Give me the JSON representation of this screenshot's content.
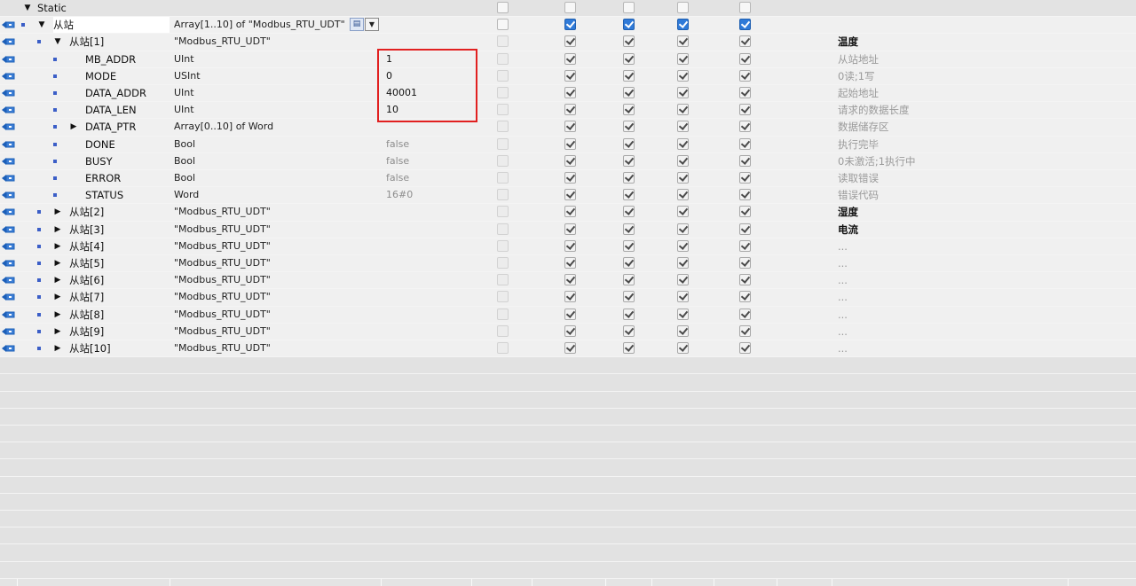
{
  "rows": [
    {
      "level": 0,
      "expander": "down",
      "icon": false,
      "name": "Static",
      "type": "",
      "value": "",
      "comment": "",
      "hdr": true,
      "cbs": [
        "grey",
        "grey",
        "grey",
        "grey",
        "grey"
      ]
    },
    {
      "level": 1,
      "expander": "down",
      "icon": true,
      "name": "从站",
      "type": "Array[1..10] of \"Modbus_RTU_UDT\"",
      "value": "",
      "comment": "",
      "selected": true,
      "cbs": [
        "grey",
        "blue",
        "blue",
        "blue",
        "blue"
      ],
      "col1": "grey"
    },
    {
      "level": 2,
      "expander": "down",
      "icon": true,
      "name": "从站[1]",
      "type": "\"Modbus_RTU_UDT\"",
      "value": "",
      "comment": "温度",
      "commentBold": true,
      "cbs": [
        "dis",
        "on",
        "on",
        "on",
        "on"
      ]
    },
    {
      "level": 3,
      "expander": "",
      "icon": true,
      "name": "MB_ADDR",
      "type": "UInt",
      "value": "1",
      "comment": "从站地址",
      "cbs": [
        "dis",
        "on",
        "on",
        "on",
        "on"
      ]
    },
    {
      "level": 3,
      "expander": "",
      "icon": true,
      "name": "MODE",
      "type": "USInt",
      "value": "0",
      "comment": "0读;1写",
      "cbs": [
        "dis",
        "on",
        "on",
        "on",
        "on"
      ]
    },
    {
      "level": 3,
      "expander": "",
      "icon": true,
      "name": "DATA_ADDR",
      "type": "UInt",
      "value": "40001",
      "comment": "起始地址",
      "cbs": [
        "dis",
        "on",
        "on",
        "on",
        "on"
      ]
    },
    {
      "level": 3,
      "expander": "",
      "icon": true,
      "name": "DATA_LEN",
      "type": "UInt",
      "value": "10",
      "comment": "请求的数据长度",
      "cbs": [
        "dis",
        "on",
        "on",
        "on",
        "on"
      ]
    },
    {
      "level": 3,
      "expander": "right",
      "icon": true,
      "name": "DATA_PTR",
      "type": "Array[0..10] of Word",
      "value": "",
      "comment": "数据储存区",
      "cbs": [
        "dis",
        "on",
        "on",
        "on",
        "on"
      ]
    },
    {
      "level": 3,
      "expander": "",
      "icon": true,
      "name": "DONE",
      "type": "Bool",
      "value": "false",
      "valueDim": true,
      "comment": "执行完毕",
      "cbs": [
        "dis",
        "on",
        "on",
        "on",
        "on"
      ]
    },
    {
      "level": 3,
      "expander": "",
      "icon": true,
      "name": "BUSY",
      "type": "Bool",
      "value": "false",
      "valueDim": true,
      "comment": "0未激活;1执行中",
      "cbs": [
        "dis",
        "on",
        "on",
        "on",
        "on"
      ]
    },
    {
      "level": 3,
      "expander": "",
      "icon": true,
      "name": "ERROR",
      "type": "Bool",
      "value": "false",
      "valueDim": true,
      "comment": "读取错误",
      "cbs": [
        "dis",
        "on",
        "on",
        "on",
        "on"
      ]
    },
    {
      "level": 3,
      "expander": "",
      "icon": true,
      "name": "STATUS",
      "type": "Word",
      "value": "16#0",
      "valueDim": true,
      "comment": "错误代码",
      "cbs": [
        "dis",
        "on",
        "on",
        "on",
        "on"
      ]
    },
    {
      "level": 2,
      "expander": "right",
      "icon": true,
      "name": "从站[2]",
      "type": "\"Modbus_RTU_UDT\"",
      "value": "",
      "comment": "湿度",
      "commentBold": true,
      "cbs": [
        "dis",
        "on",
        "on",
        "on",
        "on"
      ]
    },
    {
      "level": 2,
      "expander": "right",
      "icon": true,
      "name": "从站[3]",
      "type": "\"Modbus_RTU_UDT\"",
      "value": "",
      "comment": "电流",
      "commentBold": true,
      "cbs": [
        "dis",
        "on",
        "on",
        "on",
        "on"
      ]
    },
    {
      "level": 2,
      "expander": "right",
      "icon": true,
      "name": "从站[4]",
      "type": "\"Modbus_RTU_UDT\"",
      "value": "",
      "comment": "...",
      "cbs": [
        "dis",
        "on",
        "on",
        "on",
        "on"
      ]
    },
    {
      "level": 2,
      "expander": "right",
      "icon": true,
      "name": "从站[5]",
      "type": "\"Modbus_RTU_UDT\"",
      "value": "",
      "comment": "...",
      "cbs": [
        "dis",
        "on",
        "on",
        "on",
        "on"
      ]
    },
    {
      "level": 2,
      "expander": "right",
      "icon": true,
      "name": "从站[6]",
      "type": "\"Modbus_RTU_UDT\"",
      "value": "",
      "comment": "...",
      "cbs": [
        "dis",
        "on",
        "on",
        "on",
        "on"
      ]
    },
    {
      "level": 2,
      "expander": "right",
      "icon": true,
      "name": "从站[7]",
      "type": "\"Modbus_RTU_UDT\"",
      "value": "",
      "comment": "...",
      "cbs": [
        "dis",
        "on",
        "on",
        "on",
        "on"
      ]
    },
    {
      "level": 2,
      "expander": "right",
      "icon": true,
      "name": "从站[8]",
      "type": "\"Modbus_RTU_UDT\"",
      "value": "",
      "comment": "...",
      "cbs": [
        "dis",
        "on",
        "on",
        "on",
        "on"
      ]
    },
    {
      "level": 2,
      "expander": "right",
      "icon": true,
      "name": "从站[9]",
      "type": "\"Modbus_RTU_UDT\"",
      "value": "",
      "comment": "...",
      "cbs": [
        "dis",
        "on",
        "on",
        "on",
        "on"
      ]
    },
    {
      "level": 2,
      "expander": "right",
      "icon": true,
      "name": "从站[10]",
      "type": "\"Modbus_RTU_UDT\"",
      "value": "",
      "comment": "...",
      "cbs": [
        "dis",
        "on",
        "on",
        "on",
        "on"
      ]
    }
  ],
  "emptyRows": 13,
  "icons": {
    "row": "db-row-icon",
    "expanded": "triangle-down-icon",
    "collapsed": "triangle-right-icon",
    "member": "member-square-icon"
  },
  "colors": {
    "accent": "#2f7ad8",
    "highlight": "#e12020",
    "memberDot": "#3b5ec7"
  }
}
